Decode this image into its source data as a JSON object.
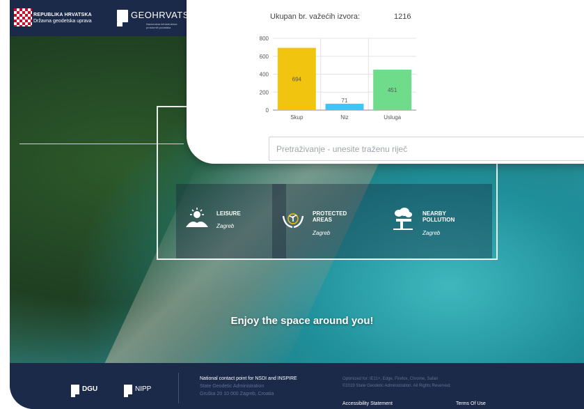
{
  "header": {
    "org_line1": "REPUBLIKA HRVATSKA",
    "org_line2": "Državna geodetska uprava",
    "brand": "GEOHRVATS",
    "brand_sub": "Nacionalna infrastruktura prostornih podataka"
  },
  "popup": {
    "count_label": "Ukupan br. važećih izvora:",
    "count_value": "1216",
    "search_placeholder": "Pretraživanje - unesite traženu riječ"
  },
  "chart_data": {
    "type": "bar",
    "categories": [
      "Skup",
      "Niz",
      "Usluga"
    ],
    "values": [
      694,
      71,
      451
    ],
    "colors": [
      "#f1c40f",
      "#3bc8f0",
      "#6fdc8c"
    ],
    "yticks": [
      0,
      200,
      400,
      600,
      800
    ],
    "ylim": [
      0,
      800
    ],
    "grid": true
  },
  "tiles": [
    {
      "title": "LEISURE",
      "subtitle": "Zagreb",
      "icon": "sun-landscape-icon"
    },
    {
      "title": "PROTECTED AREAS",
      "subtitle": "Zagreb",
      "icon": "hands-plant-icon"
    },
    {
      "title": "NEARBY POLLUTION",
      "subtitle": "Zagreb",
      "icon": "factory-cloud-icon"
    }
  ],
  "tagline": "Enjoy the space around you!",
  "footer": {
    "logo1": "DGU",
    "logo2": "NIPP",
    "contact_title": "National contact point for NSDI and INSPIRE",
    "contact_org": "State Geodetic Administration",
    "contact_address": "Gruška 20 10 000 Zagreb, Croatia",
    "optimized": "Optimized for: IE11+, Edge, Firefox, Chrome, Safari",
    "copyright": "©2019 State Geodetic Administration. All Rights Reserved.",
    "accessibility": "Accessibility Statement",
    "terms": "Terms Of Use"
  }
}
